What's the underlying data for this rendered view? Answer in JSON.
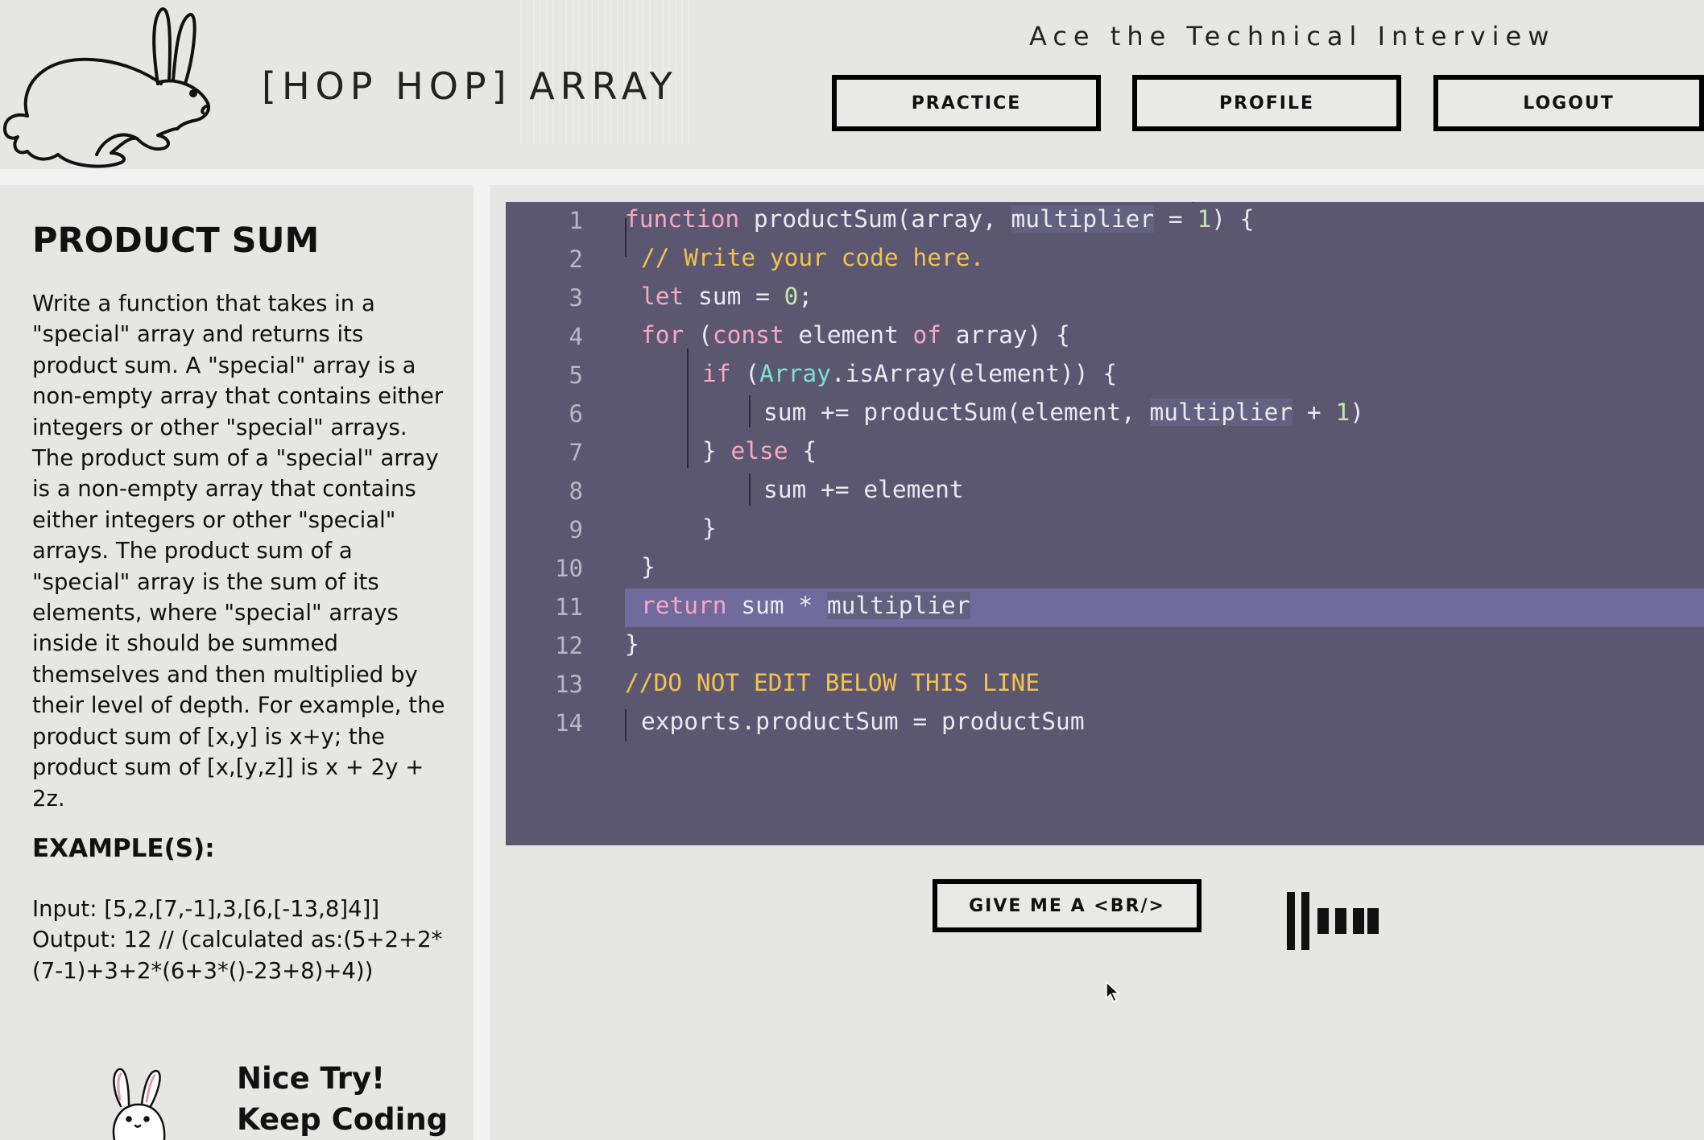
{
  "header": {
    "brand": "[HOP HOP] ARRAY",
    "tagline": "Ace the Technical Interview",
    "nav": {
      "practice": "PRACTICE",
      "profile": "PROFILE",
      "logout": "LOGOUT"
    },
    "logo_icon": "rabbit-outline-icon"
  },
  "problem": {
    "title": "PRODUCT SUM",
    "description": "Write a function that takes in a \"special\" array and returns its product sum. A \"special\" array is a non-empty array that contains either integers or other \"special\" arrays. The product sum of a \"special\" array is a non-empty array that contains either integers or other \"special\" arrays. The product sum of a \"special\" array is the sum of its elements, where \"special\" arrays inside it should be summed themselves and then multiplied by their level of depth. For example, the product sum of [x,y] is x+y; the product sum of [x,[y,z]] is x + 2y + 2z.",
    "examples_heading": "EXAMPLE(S):",
    "example_input": "Input: [5,2,[7,-1],3,[6,[-13,8]4]]",
    "example_output": "Output: 12 // (calculated as:(5+2+2*(7-1)+3+2*(6+3*()-23+8)+4))"
  },
  "feedback": {
    "line1": "Nice Try!",
    "line2": "Keep Coding"
  },
  "editor": {
    "line_numbers": [
      "1",
      "2",
      "3",
      "4",
      "5",
      "6",
      "7",
      "8",
      "9",
      "10",
      "11",
      "12",
      "13",
      "14"
    ],
    "active_line": 11,
    "colors": {
      "background": "#5b5771",
      "active_line": "#716a9c",
      "keyword": "#f7a8c4",
      "comment": "#f4c24d",
      "number": "#c4e8b0",
      "builtin": "#7fe0d0"
    }
  },
  "actions": {
    "br_button": "GIVE ME A <BR/>",
    "loader_icon": "audio-bars-loader-icon"
  }
}
